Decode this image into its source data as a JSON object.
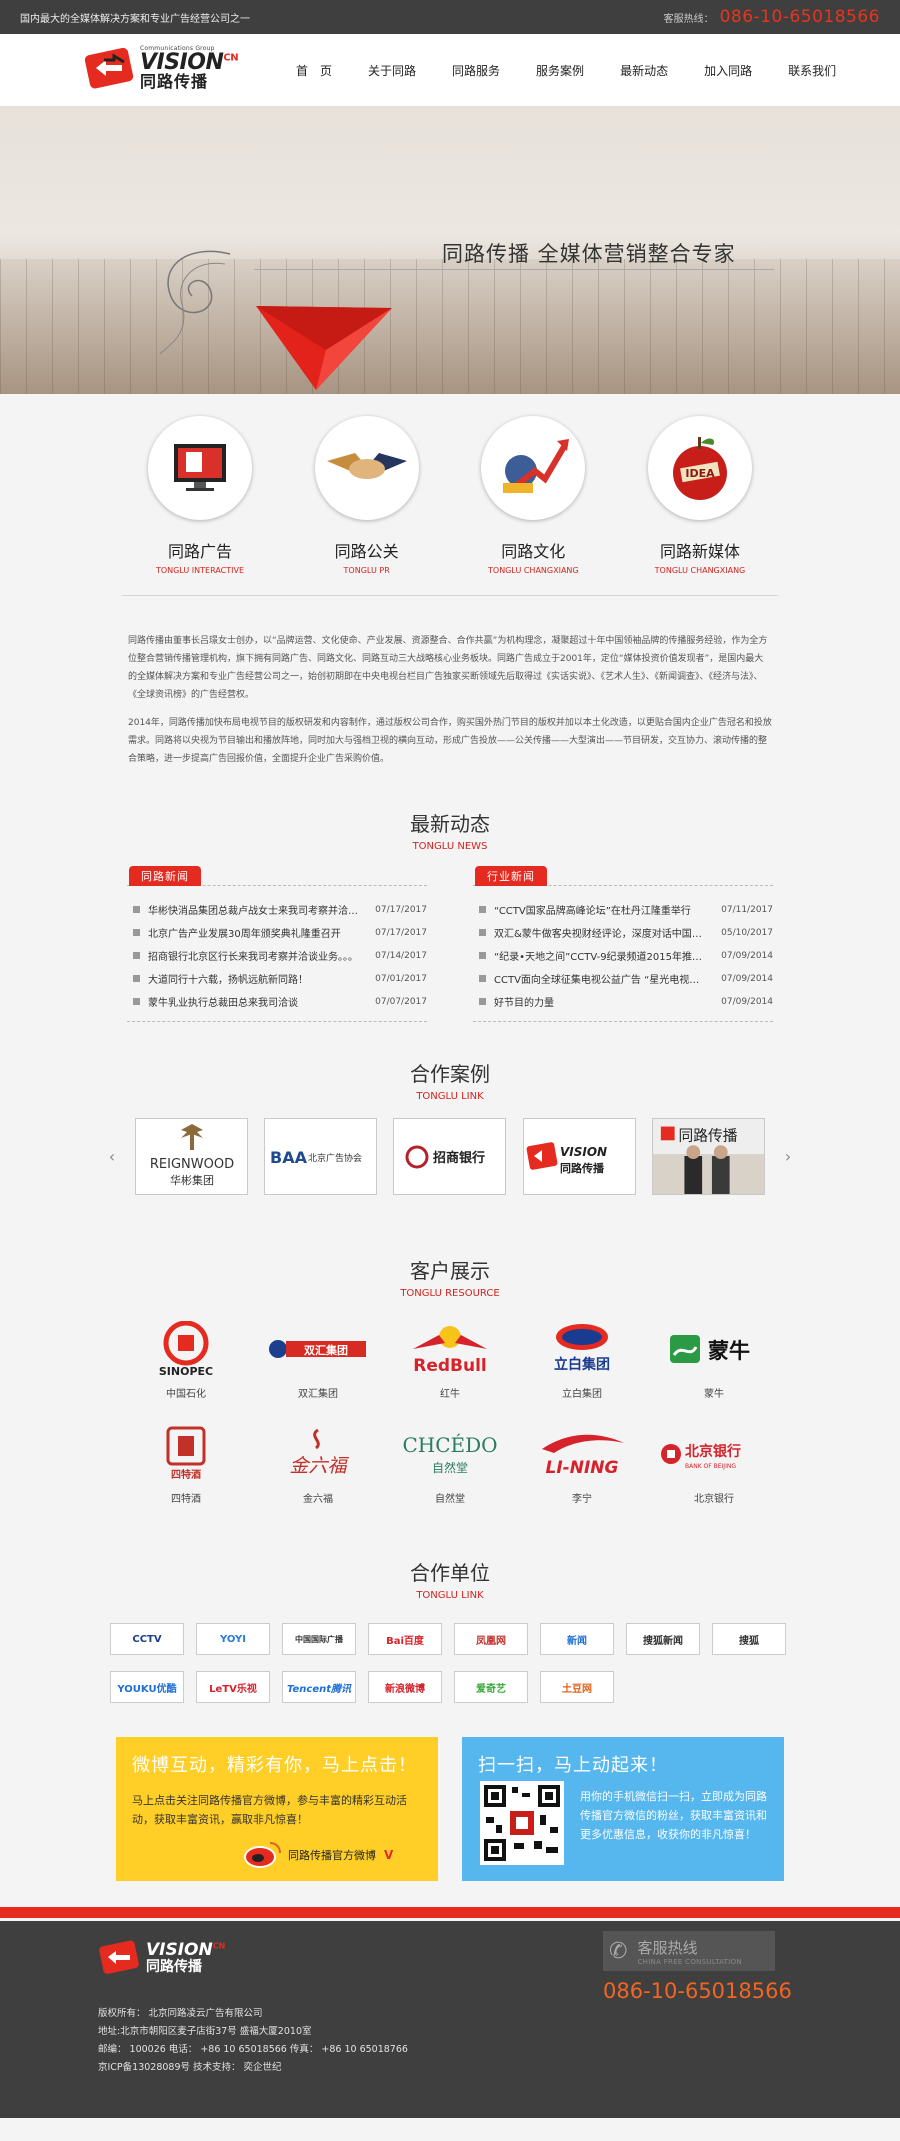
{
  "topbar": {
    "slogan": "国内最大的全媒体解决方案和专业广告经营公司之一",
    "hotline_label": "客服热线：",
    "hotline": "086-10-65018566"
  },
  "logo": {
    "en_small": "Communications Group",
    "en": "VISION",
    "en_sup": "CN",
    "cn": "同路传播"
  },
  "nav": [
    "首　页",
    "关于同路",
    "同路服务",
    "服务案例",
    "最新动态",
    "加入同路",
    "联系我们"
  ],
  "banner": {
    "tagline": "同路传播  全媒体营销整合专家"
  },
  "services": [
    {
      "title": "同路广告",
      "sub": "TONGLU INTERACTIVE"
    },
    {
      "title": "同路公关",
      "sub": "TONGLU PR"
    },
    {
      "title": "同路文化",
      "sub": "TONGLU CHANGXIANG"
    },
    {
      "title": "同路新媒体",
      "sub": "TONGLU CHANGXIANG"
    }
  ],
  "about": [
    "同路传播由董事长吕璟女士创办，以“品牌运营、文化使命、产业发展、资源整合、合作共赢”为机构理念，凝聚超过十年中国领袖品牌的传播服务经验，作为全方位整合营销传播管理机构，旗下拥有同路广告、同路文化、同路互动三大战略核心业务板块。同路广告成立于2001年，定位“媒体投资价值发现者”，是国内最大的全媒体解决方案和专业广告经营公司之一，始创初期即在中央电视台栏目广告独家买断领域先后取得过《实话实说》、《艺术人生》、《新闻调查》、《经济与法》、《全球资讯榜》的广告经营权。",
    "2014年，同路传播加快布局电视节目的版权研发和内容制作，通过版权公司合作，购买国外热门节目的版权并加以本土化改造，以更贴合国内企业广告冠名和投放需求。同路将以央视为节目输出和播放阵地，同时加大与强档卫视的横向互动，形成广告投放——公关传播——大型演出——节目研发，交互协力、滚动传播的整合策略，进一步提高广告回报价值，全面提升企业广告采购价值。"
  ],
  "news": {
    "title": "最新动态",
    "sub": "TONGLU NEWS",
    "left": {
      "label": "同路新闻",
      "items": [
        {
          "text": "华彬快消品集团总裁卢战女士来我司考察并洽谈合作",
          "date": "07/17/2017"
        },
        {
          "text": "北京广告产业发展30周年颁奖典礼隆重召开",
          "date": "07/17/2017"
        },
        {
          "text": "招商银行北京区行长来我司考察并洽谈业务。。。",
          "date": "07/14/2017"
        },
        {
          "text": "大道同行十六载，扬帆远航新同路！",
          "date": "07/01/2017"
        },
        {
          "text": "蒙牛乳业执行总裁田总来我司洽谈",
          "date": "07/07/2017"
        }
      ]
    },
    "right": {
      "label": "行业新闻",
      "items": [
        {
          "text": "“CCTV国家品牌高峰论坛”在杜丹江隆重举行",
          "date": "07/11/2017"
        },
        {
          "text": "双汇&蒙牛做客央视财经评论，深度对话中国品牌",
          "date": "05/10/2017"
        },
        {
          "text": "“纪录•天地之间”CCTV-9纪录频道2015年推介会",
          "date": "07/09/2014"
        },
        {
          "text": "CCTV面向全球征集电视公益广告 “星光电视公益广告”",
          "date": "07/09/2014"
        },
        {
          "text": "好节目的力量",
          "date": "07/09/2014"
        }
      ]
    }
  },
  "cases": {
    "title": "合作案例",
    "sub": "TONGLU LINK",
    "items": [
      "华彬集团",
      "北京广告协会",
      "招商银行",
      "同路传播",
      "同路传播合影"
    ],
    "prev": "‹",
    "next": "›"
  },
  "clients": {
    "title": "客户展示",
    "sub": "TONGLU RESOURCE",
    "items": [
      "中国石化",
      "双汇集团",
      "红牛",
      "立白集团",
      "蒙牛",
      "四特酒",
      "金六福",
      "自然堂",
      "李宁",
      "北京银行"
    ],
    "logos": {
      "shuanghui": "双汇集团",
      "redbull": "RedBull",
      "libai": "立白集团",
      "mengniu": "蒙牛",
      "site": "四特酒",
      "jinliufu": "金六福",
      "chcedo": "CHCÉDO",
      "chcedo_cn": "自然堂",
      "lining": "LI-NING",
      "bob": "北京银行",
      "bob_en": "BANK OF BEIJING",
      "sinopec": "SINOPEC",
      "reignwood": "REIGNWOOD",
      "reignwood_cn": "华彬集团",
      "baa": "BAA",
      "baa_cn": "北京广告协会",
      "cmb": "招商银行"
    }
  },
  "partners": {
    "title": "合作单位",
    "sub": "TONGLU LINK",
    "items": [
      "CCTV",
      "YOYI",
      "中国国际广播",
      "Bai百度",
      "凤凰网",
      "新闻",
      "搜狐新闻",
      "搜狐",
      "YOUKU优酷",
      "LeTV乐视",
      "Tencent腾讯",
      "新浪微博",
      "爱奇艺",
      "土豆网"
    ]
  },
  "promo": {
    "weibo": {
      "title": "微博互动，精彩有你，马上点击！",
      "desc": "马上点击关注同路传播官方微博，参与丰富的精彩互动活动，获取丰富资讯，赢取非凡惊喜！",
      "link": "同路传播官方微博",
      "v": "V"
    },
    "wechat": {
      "title": "扫一扫，马上动起来！",
      "desc": "用你的手机微信扫一扫，立即成为同路传播官方微信的粉丝，获取丰富资讯和更多优惠信息，收获你的非凡惊喜！"
    }
  },
  "footer": {
    "lines": [
      "版权所有：  北京同路凌云广告有限公司",
      "地址:北京市朝阳区麦子店街37号 盛福大厦2010室",
      "邮编：  100026 电话：  +86 10 65018566 传真：  +86 10 65018766",
      "京ICP备13028089号 技术支持：  奕企世纪"
    ],
    "hot_cn": "客服热线",
    "hot_en": "CHINA FREE CONSULTATION",
    "hot_num": "086-10-65018566"
  },
  "colors": {
    "brand_red": "#e52b20",
    "dark": "#3f3f3f",
    "promo_yellow": "#ffce27",
    "promo_blue": "#56b6ee",
    "hotline_orange": "#f26522"
  }
}
